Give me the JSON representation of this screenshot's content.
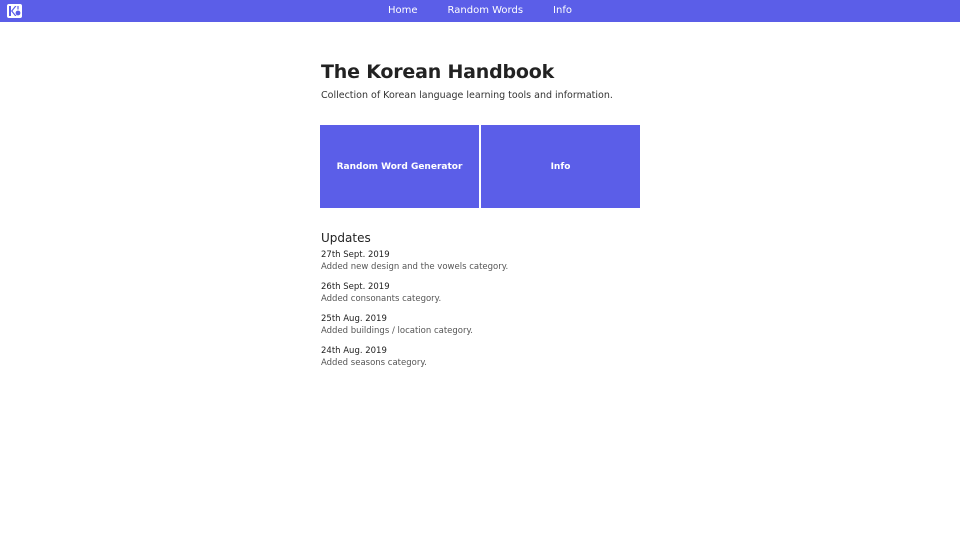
{
  "nav": {
    "logo_icon": "korean-handbook-logo-icon",
    "items": [
      {
        "label": "Home"
      },
      {
        "label": "Random Words"
      },
      {
        "label": "Info"
      }
    ]
  },
  "header": {
    "title": "The Korean Handbook",
    "subtitle": "Collection of Korean language learning tools and information."
  },
  "cards": [
    {
      "label": "Random Word Generator"
    },
    {
      "label": "Info"
    }
  ],
  "updates": {
    "heading": "Updates",
    "entries": [
      {
        "date": "27th Sept. 2019",
        "text": "Added new design and the vowels category."
      },
      {
        "date": "26th Sept. 2019",
        "text": "Added consonants category."
      },
      {
        "date": "25th Aug. 2019",
        "text": "Added buildings / location category."
      },
      {
        "date": "24th Aug. 2019",
        "text": "Added seasons category."
      }
    ]
  },
  "colors": {
    "accent": "#5b5ee8",
    "background": "#ffffff"
  }
}
